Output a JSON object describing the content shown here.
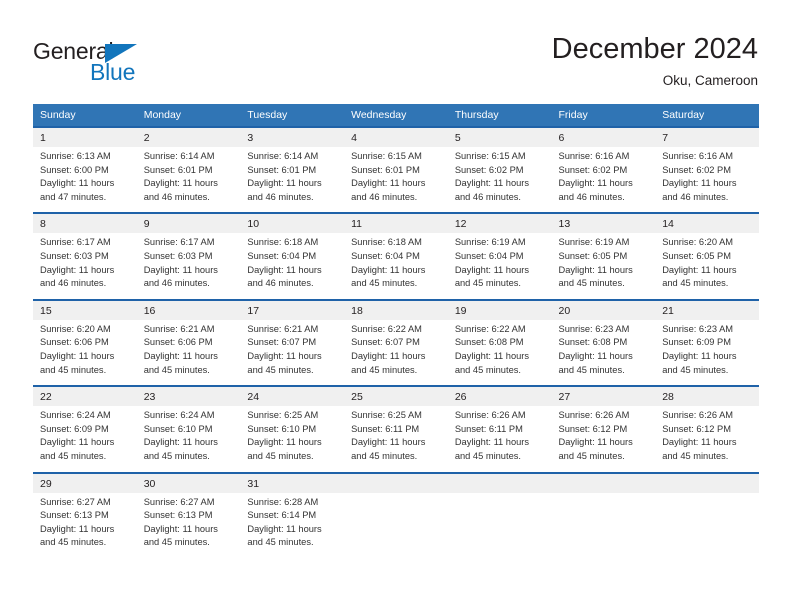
{
  "logo": {
    "word_general": "General",
    "word_blue": "Blue",
    "triangle_color": "#1275bc"
  },
  "header": {
    "title": "December 2024",
    "subtitle": "Oku, Cameroon"
  },
  "theme": {
    "header_blue": "#3075b5",
    "separator_blue": "#1f62a8",
    "daynum_bg": "#f0f0f0",
    "text": "#231f20"
  },
  "calendar": {
    "weekday_headers": [
      "Sunday",
      "Monday",
      "Tuesday",
      "Wednesday",
      "Thursday",
      "Friday",
      "Saturday"
    ],
    "weeks": [
      {
        "days": [
          {
            "date": "1",
            "sunrise": "Sunrise: 6:13 AM",
            "sunset": "Sunset: 6:00 PM",
            "daylight_line1": "Daylight: 11 hours",
            "daylight_line2": "and 47 minutes."
          },
          {
            "date": "2",
            "sunrise": "Sunrise: 6:14 AM",
            "sunset": "Sunset: 6:01 PM",
            "daylight_line1": "Daylight: 11 hours",
            "daylight_line2": "and 46 minutes."
          },
          {
            "date": "3",
            "sunrise": "Sunrise: 6:14 AM",
            "sunset": "Sunset: 6:01 PM",
            "daylight_line1": "Daylight: 11 hours",
            "daylight_line2": "and 46 minutes."
          },
          {
            "date": "4",
            "sunrise": "Sunrise: 6:15 AM",
            "sunset": "Sunset: 6:01 PM",
            "daylight_line1": "Daylight: 11 hours",
            "daylight_line2": "and 46 minutes."
          },
          {
            "date": "5",
            "sunrise": "Sunrise: 6:15 AM",
            "sunset": "Sunset: 6:02 PM",
            "daylight_line1": "Daylight: 11 hours",
            "daylight_line2": "and 46 minutes."
          },
          {
            "date": "6",
            "sunrise": "Sunrise: 6:16 AM",
            "sunset": "Sunset: 6:02 PM",
            "daylight_line1": "Daylight: 11 hours",
            "daylight_line2": "and 46 minutes."
          },
          {
            "date": "7",
            "sunrise": "Sunrise: 6:16 AM",
            "sunset": "Sunset: 6:02 PM",
            "daylight_line1": "Daylight: 11 hours",
            "daylight_line2": "and 46 minutes."
          }
        ]
      },
      {
        "days": [
          {
            "date": "8",
            "sunrise": "Sunrise: 6:17 AM",
            "sunset": "Sunset: 6:03 PM",
            "daylight_line1": "Daylight: 11 hours",
            "daylight_line2": "and 46 minutes."
          },
          {
            "date": "9",
            "sunrise": "Sunrise: 6:17 AM",
            "sunset": "Sunset: 6:03 PM",
            "daylight_line1": "Daylight: 11 hours",
            "daylight_line2": "and 46 minutes."
          },
          {
            "date": "10",
            "sunrise": "Sunrise: 6:18 AM",
            "sunset": "Sunset: 6:04 PM",
            "daylight_line1": "Daylight: 11 hours",
            "daylight_line2": "and 46 minutes."
          },
          {
            "date": "11",
            "sunrise": "Sunrise: 6:18 AM",
            "sunset": "Sunset: 6:04 PM",
            "daylight_line1": "Daylight: 11 hours",
            "daylight_line2": "and 45 minutes."
          },
          {
            "date": "12",
            "sunrise": "Sunrise: 6:19 AM",
            "sunset": "Sunset: 6:04 PM",
            "daylight_line1": "Daylight: 11 hours",
            "daylight_line2": "and 45 minutes."
          },
          {
            "date": "13",
            "sunrise": "Sunrise: 6:19 AM",
            "sunset": "Sunset: 6:05 PM",
            "daylight_line1": "Daylight: 11 hours",
            "daylight_line2": "and 45 minutes."
          },
          {
            "date": "14",
            "sunrise": "Sunrise: 6:20 AM",
            "sunset": "Sunset: 6:05 PM",
            "daylight_line1": "Daylight: 11 hours",
            "daylight_line2": "and 45 minutes."
          }
        ]
      },
      {
        "days": [
          {
            "date": "15",
            "sunrise": "Sunrise: 6:20 AM",
            "sunset": "Sunset: 6:06 PM",
            "daylight_line1": "Daylight: 11 hours",
            "daylight_line2": "and 45 minutes."
          },
          {
            "date": "16",
            "sunrise": "Sunrise: 6:21 AM",
            "sunset": "Sunset: 6:06 PM",
            "daylight_line1": "Daylight: 11 hours",
            "daylight_line2": "and 45 minutes."
          },
          {
            "date": "17",
            "sunrise": "Sunrise: 6:21 AM",
            "sunset": "Sunset: 6:07 PM",
            "daylight_line1": "Daylight: 11 hours",
            "daylight_line2": "and 45 minutes."
          },
          {
            "date": "18",
            "sunrise": "Sunrise: 6:22 AM",
            "sunset": "Sunset: 6:07 PM",
            "daylight_line1": "Daylight: 11 hours",
            "daylight_line2": "and 45 minutes."
          },
          {
            "date": "19",
            "sunrise": "Sunrise: 6:22 AM",
            "sunset": "Sunset: 6:08 PM",
            "daylight_line1": "Daylight: 11 hours",
            "daylight_line2": "and 45 minutes."
          },
          {
            "date": "20",
            "sunrise": "Sunrise: 6:23 AM",
            "sunset": "Sunset: 6:08 PM",
            "daylight_line1": "Daylight: 11 hours",
            "daylight_line2": "and 45 minutes."
          },
          {
            "date": "21",
            "sunrise": "Sunrise: 6:23 AM",
            "sunset": "Sunset: 6:09 PM",
            "daylight_line1": "Daylight: 11 hours",
            "daylight_line2": "and 45 minutes."
          }
        ]
      },
      {
        "days": [
          {
            "date": "22",
            "sunrise": "Sunrise: 6:24 AM",
            "sunset": "Sunset: 6:09 PM",
            "daylight_line1": "Daylight: 11 hours",
            "daylight_line2": "and 45 minutes."
          },
          {
            "date": "23",
            "sunrise": "Sunrise: 6:24 AM",
            "sunset": "Sunset: 6:10 PM",
            "daylight_line1": "Daylight: 11 hours",
            "daylight_line2": "and 45 minutes."
          },
          {
            "date": "24",
            "sunrise": "Sunrise: 6:25 AM",
            "sunset": "Sunset: 6:10 PM",
            "daylight_line1": "Daylight: 11 hours",
            "daylight_line2": "and 45 minutes."
          },
          {
            "date": "25",
            "sunrise": "Sunrise: 6:25 AM",
            "sunset": "Sunset: 6:11 PM",
            "daylight_line1": "Daylight: 11 hours",
            "daylight_line2": "and 45 minutes."
          },
          {
            "date": "26",
            "sunrise": "Sunrise: 6:26 AM",
            "sunset": "Sunset: 6:11 PM",
            "daylight_line1": "Daylight: 11 hours",
            "daylight_line2": "and 45 minutes."
          },
          {
            "date": "27",
            "sunrise": "Sunrise: 6:26 AM",
            "sunset": "Sunset: 6:12 PM",
            "daylight_line1": "Daylight: 11 hours",
            "daylight_line2": "and 45 minutes."
          },
          {
            "date": "28",
            "sunrise": "Sunrise: 6:26 AM",
            "sunset": "Sunset: 6:12 PM",
            "daylight_line1": "Daylight: 11 hours",
            "daylight_line2": "and 45 minutes."
          }
        ]
      },
      {
        "days": [
          {
            "date": "29",
            "sunrise": "Sunrise: 6:27 AM",
            "sunset": "Sunset: 6:13 PM",
            "daylight_line1": "Daylight: 11 hours",
            "daylight_line2": "and 45 minutes."
          },
          {
            "date": "30",
            "sunrise": "Sunrise: 6:27 AM",
            "sunset": "Sunset: 6:13 PM",
            "daylight_line1": "Daylight: 11 hours",
            "daylight_line2": "and 45 minutes."
          },
          {
            "date": "31",
            "sunrise": "Sunrise: 6:28 AM",
            "sunset": "Sunset: 6:14 PM",
            "daylight_line1": "Daylight: 11 hours",
            "daylight_line2": "and 45 minutes."
          },
          {
            "date": "",
            "sunrise": "",
            "sunset": "",
            "daylight_line1": "",
            "daylight_line2": ""
          },
          {
            "date": "",
            "sunrise": "",
            "sunset": "",
            "daylight_line1": "",
            "daylight_line2": ""
          },
          {
            "date": "",
            "sunrise": "",
            "sunset": "",
            "daylight_line1": "",
            "daylight_line2": ""
          },
          {
            "date": "",
            "sunrise": "",
            "sunset": "",
            "daylight_line1": "",
            "daylight_line2": ""
          }
        ]
      }
    ]
  }
}
